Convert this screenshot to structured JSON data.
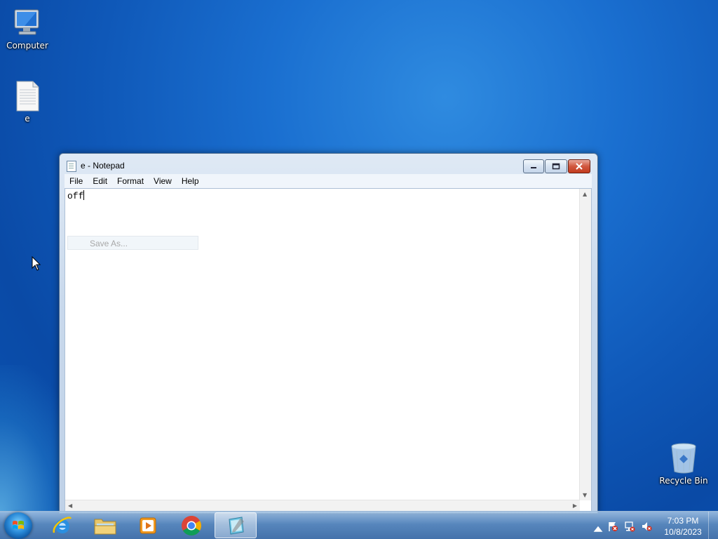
{
  "desktop": {
    "icons": [
      {
        "label": "Computer"
      },
      {
        "label": "e"
      },
      {
        "label": "Recycle Bin"
      }
    ]
  },
  "window": {
    "title": "e - Notepad",
    "menu": [
      "File",
      "Edit",
      "Format",
      "View",
      "Help"
    ],
    "content": "off",
    "ghost_menu_item": "Save As..."
  },
  "taskbar": {
    "apps": [
      "internet-explorer-icon",
      "windows-explorer-icon",
      "media-player-icon",
      "chrome-icon",
      "notepad-icon"
    ],
    "active_app": "notepad-icon",
    "clock": {
      "time": "7:03 PM",
      "date": "10/8/2023"
    }
  },
  "colors": {
    "desktop_bg": "#1464c8",
    "close_button": "#c8432a"
  }
}
